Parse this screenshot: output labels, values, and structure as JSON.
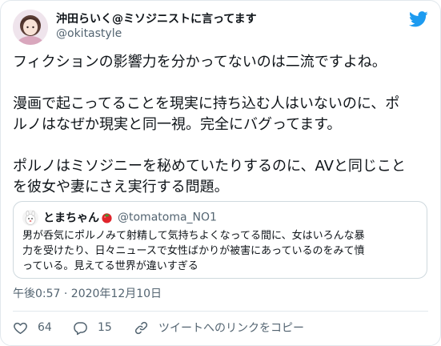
{
  "tweet": {
    "author": {
      "display_name": "沖田らいく@ミソジニストに言ってます",
      "handle": "@okitastyle"
    },
    "paragraphs": [
      "フィクションの影響力を分かってないのは二流ですよね。",
      "漫画で起こってることを現実に持ち込む人はいないのに、ポ\nルノはなぜか現実と同一視。完全にバグってます。",
      "ポルノはミソジニーを秘めていたりするのに、AVと同じこと\nを彼女や妻にさえ実行する問題。"
    ],
    "timestamp": "午後0:57 · 2020年12月10日"
  },
  "quoted_tweet": {
    "display_name": "とまちゃん",
    "emoji": "tomato-emoji",
    "handle": "@tomatoma_NO1",
    "text": "男が呑気にポルノみて射精して気持ちよくなってる間に、女はいろんな暴\n力を受けたり、日々ニュースで女性ばかりが被害にあっているのをみて憤\nっている。見えてる世界が違いすぎる"
  },
  "actions": {
    "like": {
      "icon": "heart-icon",
      "count": "64"
    },
    "reply": {
      "icon": "reply-icon",
      "count": "15"
    },
    "copy_link": {
      "icon": "link-icon",
      "label": "ツイートへのリンクをコピー"
    }
  },
  "brand": {
    "logo": "twitter-bird-icon",
    "accent_color": "#1d9bf0",
    "text_color": "#0f1419",
    "muted_color": "#536471",
    "border_color": "#cfd9de"
  }
}
